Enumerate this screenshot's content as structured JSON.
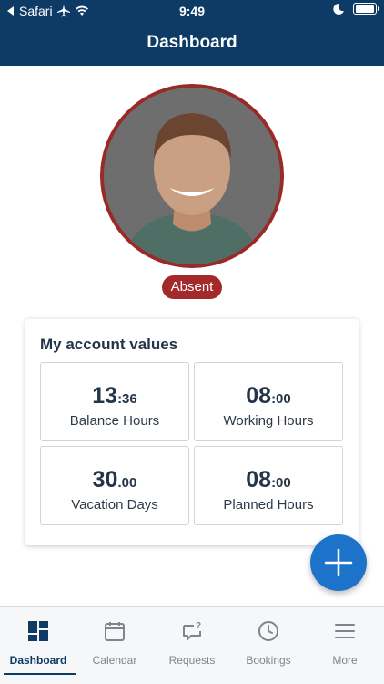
{
  "status_bar": {
    "back_app": "Safari",
    "time": "9:49"
  },
  "header": {
    "title": "Dashboard"
  },
  "profile": {
    "status_badge": "Absent"
  },
  "account_values": {
    "title": "My account values",
    "tiles": [
      {
        "big": "13",
        "small": ":36",
        "label": "Balance Hours"
      },
      {
        "big": "08",
        "small": ":00",
        "label": "Working Hours"
      },
      {
        "big": "30",
        "small": ".00",
        "label": "Vacation Days"
      },
      {
        "big": "08",
        "small": ":00",
        "label": "Planned Hours"
      }
    ]
  },
  "fab": {
    "icon": "plus-icon"
  },
  "tabbar": {
    "active": "Dashboard",
    "tabs": [
      {
        "label": "Dashboard",
        "icon": "dashboard-grid-icon"
      },
      {
        "label": "Calendar",
        "icon": "calendar-icon"
      },
      {
        "label": "Requests",
        "icon": "chat-question-icon"
      },
      {
        "label": "Bookings",
        "icon": "clock-icon"
      },
      {
        "label": "More",
        "icon": "menu-icon"
      }
    ]
  },
  "colors": {
    "header": "#0e3a66",
    "accent": "#1d73c9",
    "status_absent": "#a3292b"
  }
}
